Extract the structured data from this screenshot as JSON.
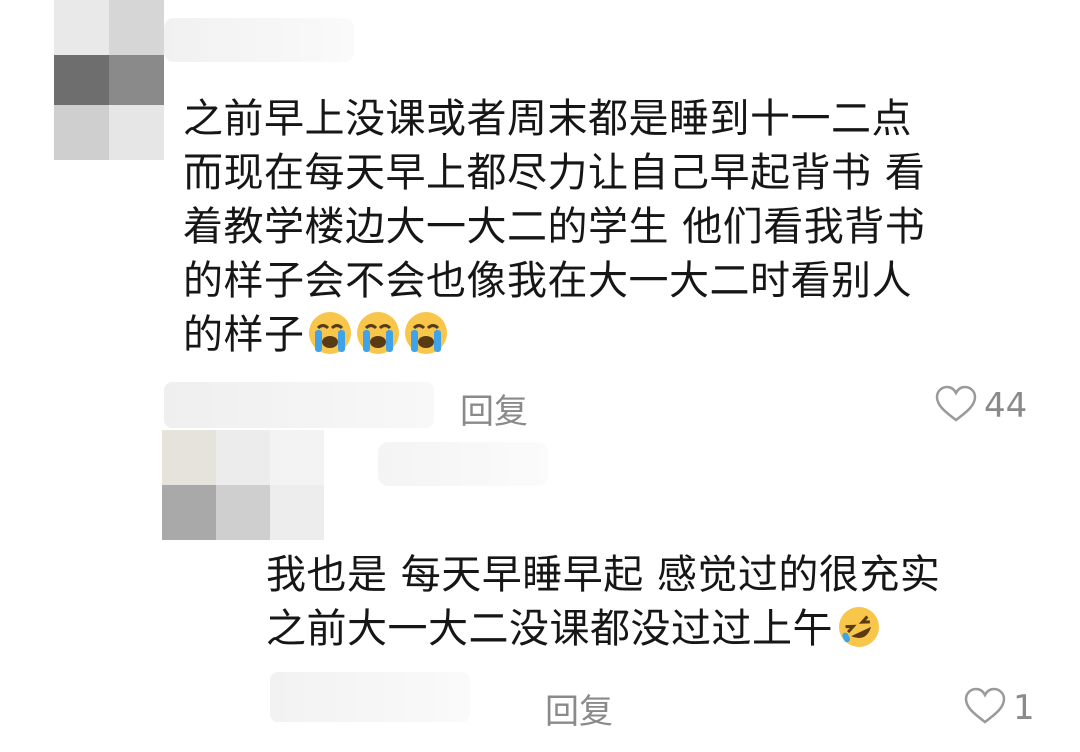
{
  "comment1": {
    "lines": [
      "之前早上没课或者周末都是睡到十一二点",
      "而现在每天早上都尽力让自己早起背书 看",
      "着教学楼边大一大二的学生 他们看我背书",
      "的样子会不会也像我在大一大二时看别人",
      "的样子"
    ],
    "emoji": [
      "loudly-crying-face",
      "loudly-crying-face",
      "loudly-crying-face"
    ],
    "reply_label": "回复",
    "like_count": "44"
  },
  "comment2": {
    "lines": [
      "我也是 每天早睡早起 感觉过的很充实",
      "之前大一大二没课都没过过上午"
    ],
    "emoji": [
      "rolling-on-floor-laughing-face"
    ],
    "reply_label": "回复",
    "like_count": "1"
  }
}
